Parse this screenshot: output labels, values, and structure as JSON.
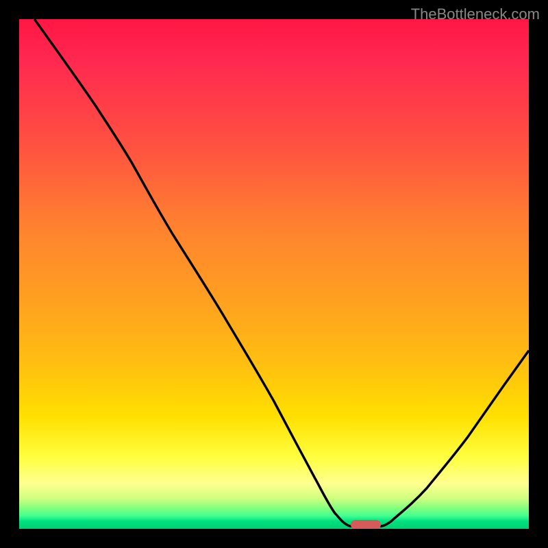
{
  "watermark": "TheBottleneck.com",
  "chart_data": {
    "type": "line",
    "title": "",
    "xlabel": "",
    "ylabel": "",
    "xlim": [
      0,
      100
    ],
    "ylim": [
      0,
      100
    ],
    "curve_points": [
      {
        "x": 3,
        "y": 100
      },
      {
        "x": 15,
        "y": 83
      },
      {
        "x": 22,
        "y": 72
      },
      {
        "x": 30,
        "y": 58
      },
      {
        "x": 40,
        "y": 42
      },
      {
        "x": 50,
        "y": 25
      },
      {
        "x": 58,
        "y": 10
      },
      {
        "x": 62,
        "y": 3
      },
      {
        "x": 65,
        "y": 0.5
      },
      {
        "x": 70,
        "y": 0.5
      },
      {
        "x": 73,
        "y": 1.5
      },
      {
        "x": 80,
        "y": 8
      },
      {
        "x": 88,
        "y": 18
      },
      {
        "x": 95,
        "y": 28
      },
      {
        "x": 100,
        "y": 35
      }
    ],
    "optimal_zone": {
      "x_start": 65,
      "x_end": 71,
      "y": 0.5
    },
    "colors": {
      "high_bottleneck": "#ff1744",
      "low_bottleneck": "#00d070",
      "marker": "#d65a5a",
      "curve": "#000000"
    }
  }
}
